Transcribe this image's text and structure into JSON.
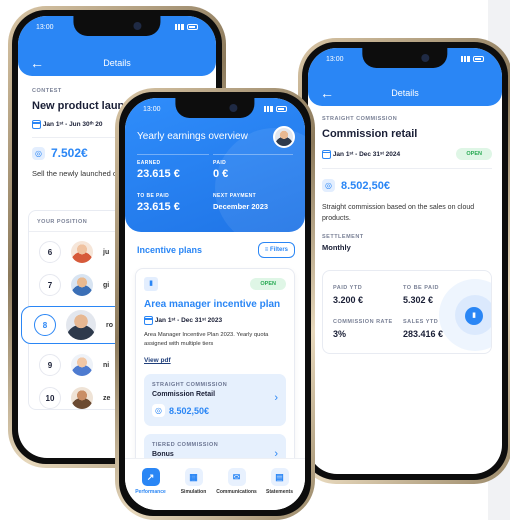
{
  "phoneA": {
    "time": "13:00",
    "title": "Details",
    "type": "CONTEST",
    "name": "New product launch",
    "dates": "Jan 1ˢᵗ - Jun 30ᵗʰ 20",
    "amount": "7.502€",
    "description": "Sell the newly launched of 10.000 €.",
    "position_label": "YOUR POSITION",
    "ranks": [
      {
        "num": "6",
        "name": "ju"
      },
      {
        "num": "7",
        "name": "gi"
      },
      {
        "num": "8",
        "name": "ro"
      },
      {
        "num": "9",
        "name": "ni"
      },
      {
        "num": "10",
        "name": "ze"
      }
    ]
  },
  "phoneB": {
    "time": "13:00",
    "header_title": "Yearly earnings overview",
    "earned_label": "EARNED",
    "earned_value": "23.615 €",
    "paid_label": "PAID",
    "paid_value": "0 €",
    "tobepaid_label": "TO BE PAID",
    "tobepaid_value": "23.615 €",
    "nextpay_label": "NEXT PAYMENT",
    "nextpay_value": "December 2023",
    "plans_title": "Incentive plans",
    "filters_label": "Filters",
    "open_badge": "OPEN",
    "plan_name": "Area manager incentive plan",
    "plan_dates": "Jan 1ˢᵗ - Dec 31ˢᵗ 2023",
    "plan_desc": "Area Manager Incentive Plan 2023. Yearly quota assigned with multiple tiers",
    "view_pdf": "View pdf",
    "sub1_type": "STRAIGHT COMMISSION",
    "sub1_name": "Commission Retail",
    "sub1_amount": "8.502,50€",
    "sub2_type": "TIERED COMMISSION",
    "sub2_name": "Bonus",
    "tabs": [
      "Performance",
      "Simulation",
      "Communications",
      "Statements"
    ]
  },
  "phoneC": {
    "time": "13:00",
    "title": "Details",
    "type": "STRAIGHT COMMISSION",
    "name": "Commission retail",
    "dates": "Jan 1ˢᵗ - Dec 31ˢᵗ 2024",
    "open_badge": "OPEN",
    "amount": "8.502,50€",
    "description": "Straight commission based on the sales on cloud products.",
    "settlement_label": "SETTLEMENT",
    "settlement_value": "Monthly",
    "paid_ytd_label": "PAID YTD",
    "paid_ytd_value": "3.200 €",
    "tobepaid_label": "TO BE PAID",
    "tobepaid_value": "5.302 €",
    "rate_label": "COMMISSION RATE",
    "rate_value": "3%",
    "sales_label": "SALES YTD",
    "sales_value": "283.416 €"
  },
  "colors": {
    "accent": "#2a86f5",
    "open_green": "#27a952"
  }
}
